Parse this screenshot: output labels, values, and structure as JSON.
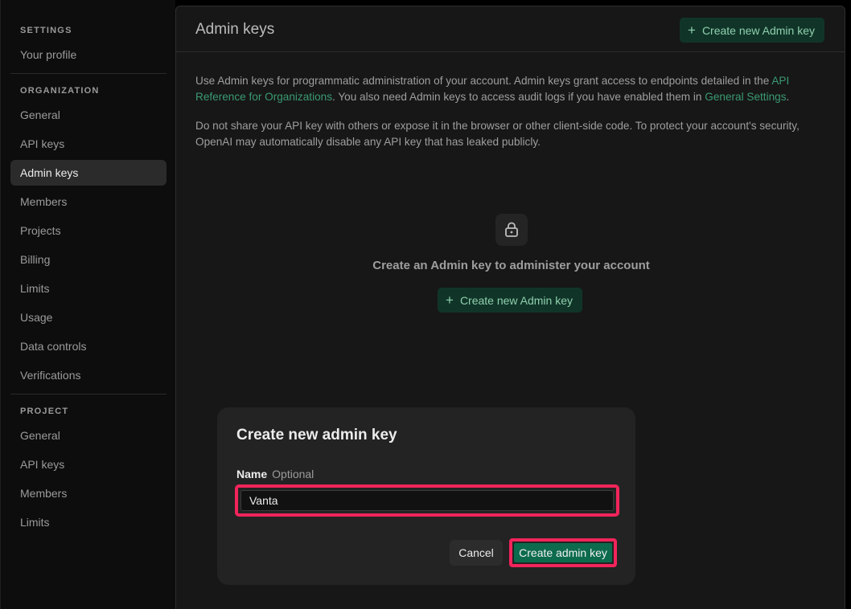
{
  "sidebar": {
    "settings_label": "SETTINGS",
    "your_profile": "Your profile",
    "organization_label": "ORGANIZATION",
    "org_items": [
      "General",
      "API keys",
      "Admin keys",
      "Members",
      "Projects",
      "Billing",
      "Limits",
      "Usage",
      "Data controls",
      "Verifications"
    ],
    "project_label": "PROJECT",
    "project_items": [
      "General",
      "API keys",
      "Members",
      "Limits"
    ]
  },
  "main": {
    "title": "Admin keys",
    "create_button": "Create new Admin key",
    "desc1_pre": "Use Admin keys for programmatic administration of your account. Admin keys grant access to endpoints detailed in the ",
    "desc1_link1": "API Reference for Organizations",
    "desc1_mid": ". You also need Admin keys to access audit logs if you have enabled them in ",
    "desc1_link2": "General Settings",
    "desc1_post": ".",
    "desc2": "Do not share your API key with others or expose it in the browser or other client-side code. To protect your account's security, OpenAI may automatically disable any API key that has leaked publicly.",
    "empty_title": "Create an Admin key to administer your account",
    "empty_button": "Create new Admin key"
  },
  "modal": {
    "title": "Create new admin key",
    "name_label": "Name",
    "name_optional": "Optional",
    "name_value": "Vanta",
    "cancel": "Cancel",
    "submit": "Create admin key"
  },
  "colors": {
    "accent_green": "#0d6b4d",
    "highlight": "#f2245b",
    "link": "#3a9a72"
  }
}
